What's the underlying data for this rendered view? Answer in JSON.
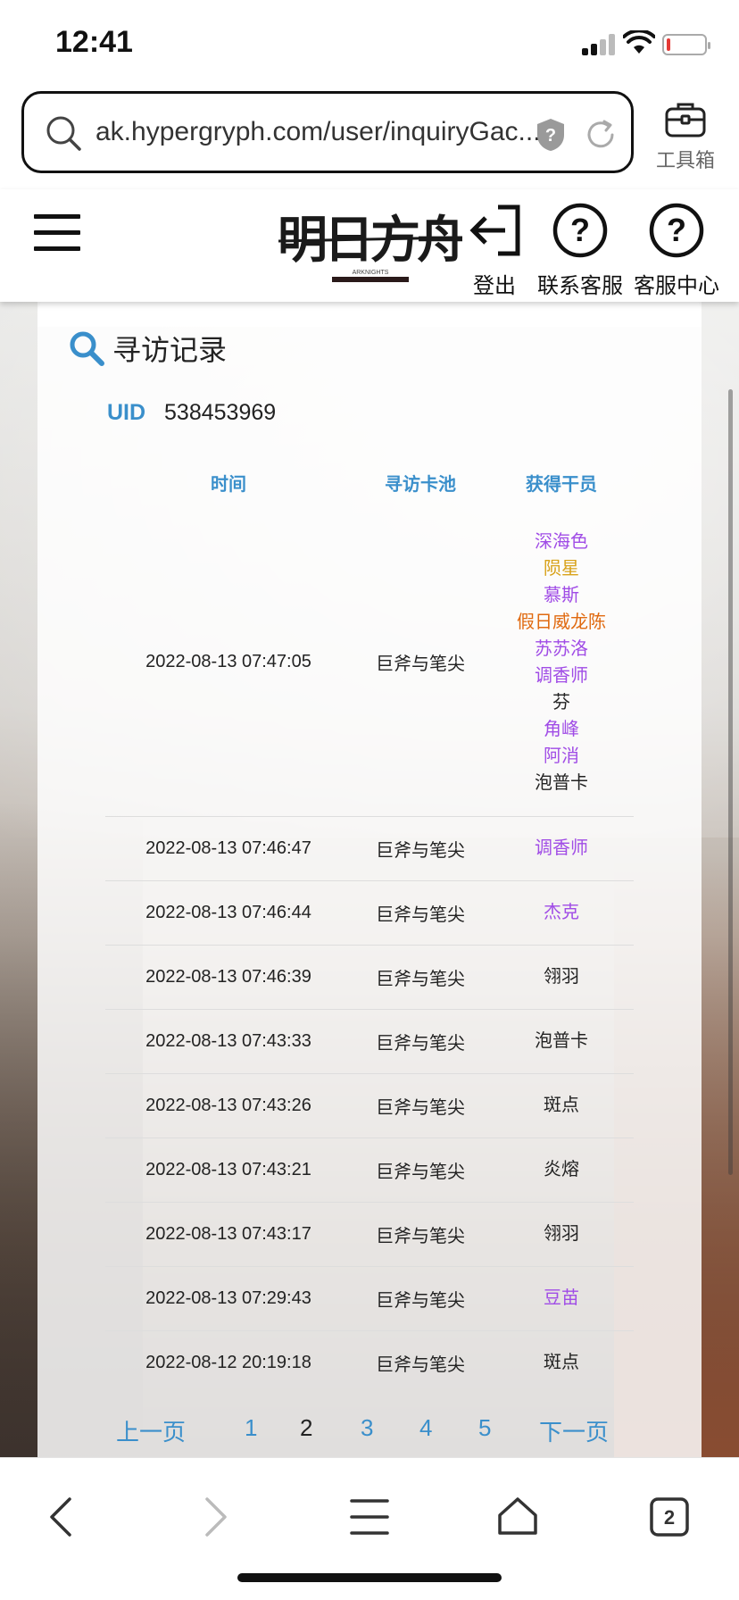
{
  "status_bar": {
    "time": "12:41"
  },
  "browser": {
    "url": "ak.hypergryph.com/user/inquiryGac...",
    "toolbox_label": "工具箱"
  },
  "header": {
    "logo_text": "明日方舟",
    "logout_label": "登出",
    "contact_label": "联系客服",
    "service_label": "客服中心"
  },
  "card": {
    "title": "寻访记录",
    "uid_label": "UID",
    "uid_value": "538453969",
    "columns": [
      "时间",
      "寻访卡池",
      "获得干员"
    ]
  },
  "records": [
    {
      "time": "2022-08-13 07:47:05",
      "pool": "巨斧与笔尖",
      "operators": [
        {
          "name": "深海色",
          "rarity_color": "purple"
        },
        {
          "name": "陨星",
          "rarity_color": "gold"
        },
        {
          "name": "慕斯",
          "rarity_color": "purple"
        },
        {
          "name": "假日威龙陈",
          "rarity_color": "orange"
        },
        {
          "name": "苏苏洛",
          "rarity_color": "purple"
        },
        {
          "name": "调香师",
          "rarity_color": "purple"
        },
        {
          "name": "芬",
          "rarity_color": "black"
        },
        {
          "name": "角峰",
          "rarity_color": "purple"
        },
        {
          "name": "阿消",
          "rarity_color": "purple"
        },
        {
          "name": "泡普卡",
          "rarity_color": "black"
        }
      ]
    },
    {
      "time": "2022-08-13 07:46:47",
      "pool": "巨斧与笔尖",
      "operators": [
        {
          "name": "调香师",
          "rarity_color": "purple"
        }
      ]
    },
    {
      "time": "2022-08-13 07:46:44",
      "pool": "巨斧与笔尖",
      "operators": [
        {
          "name": "杰克",
          "rarity_color": "purple"
        }
      ]
    },
    {
      "time": "2022-08-13 07:46:39",
      "pool": "巨斧与笔尖",
      "operators": [
        {
          "name": "翎羽",
          "rarity_color": "black"
        }
      ]
    },
    {
      "time": "2022-08-13 07:43:33",
      "pool": "巨斧与笔尖",
      "operators": [
        {
          "name": "泡普卡",
          "rarity_color": "black"
        }
      ]
    },
    {
      "time": "2022-08-13 07:43:26",
      "pool": "巨斧与笔尖",
      "operators": [
        {
          "name": "斑点",
          "rarity_color": "black"
        }
      ]
    },
    {
      "time": "2022-08-13 07:43:21",
      "pool": "巨斧与笔尖",
      "operators": [
        {
          "name": "炎熔",
          "rarity_color": "black"
        }
      ]
    },
    {
      "time": "2022-08-13 07:43:17",
      "pool": "巨斧与笔尖",
      "operators": [
        {
          "name": "翎羽",
          "rarity_color": "black"
        }
      ]
    },
    {
      "time": "2022-08-13 07:29:43",
      "pool": "巨斧与笔尖",
      "operators": [
        {
          "name": "豆苗",
          "rarity_color": "purple"
        }
      ]
    },
    {
      "time": "2022-08-12 20:19:18",
      "pool": "巨斧与笔尖",
      "operators": [
        {
          "name": "斑点",
          "rarity_color": "black"
        }
      ]
    }
  ],
  "pager": {
    "prev": "上一页",
    "pages": [
      "1",
      "2",
      "3",
      "4",
      "5"
    ],
    "current": "2",
    "next": "下一页"
  },
  "bottom_tabs": {
    "tab_count": "2"
  },
  "colors": {
    "accent": "#3a8fcb",
    "purple": "#a04ce6",
    "gold": "#d8a21a",
    "orange": "#e06a10"
  },
  "icons": [
    "search-icon",
    "shield-question-icon",
    "reload-icon",
    "toolbox-icon",
    "hamburger-icon",
    "logout-icon",
    "question-circle-icon",
    "back-icon",
    "forward-icon",
    "menu-icon",
    "home-icon",
    "tabs-icon"
  ]
}
